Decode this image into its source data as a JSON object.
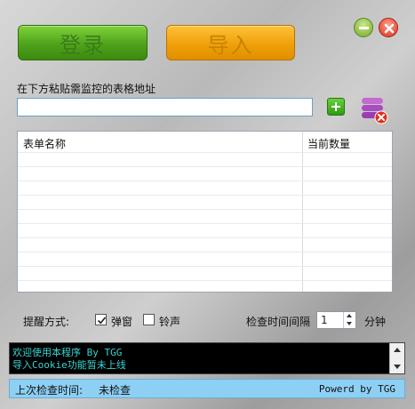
{
  "header": {
    "login_label": "登录",
    "import_label": "导入"
  },
  "window": {
    "minimize_icon": "minimize-icon",
    "close_icon": "close-icon"
  },
  "url_section": {
    "prompt": "在下方粘贴需监控的表格地址",
    "input_value": "",
    "add_icon": "plus-icon",
    "remove_icon": "database-delete-icon"
  },
  "table": {
    "columns": [
      "表单名称",
      "当前数量"
    ],
    "rows": []
  },
  "reminder": {
    "label": "提醒方式:",
    "popup_label": "弹窗",
    "popup_checked": true,
    "sound_label": "铃声",
    "sound_checked": false
  },
  "interval": {
    "label": "检查时间间隔",
    "value": "1",
    "unit": "分钟"
  },
  "log": {
    "lines": [
      "欢迎使用本程序 By TGG",
      "导入Cookie功能暂未上线"
    ]
  },
  "status": {
    "last_check_label": "上次检查时间:",
    "last_check_value": "未检查",
    "powered_by": "Powerd by TGG"
  },
  "colors": {
    "login_green": "#4fa21b",
    "import_orange": "#f0a00a",
    "log_text": "#3ad4d0",
    "status_bar": "#8ed0f4"
  }
}
